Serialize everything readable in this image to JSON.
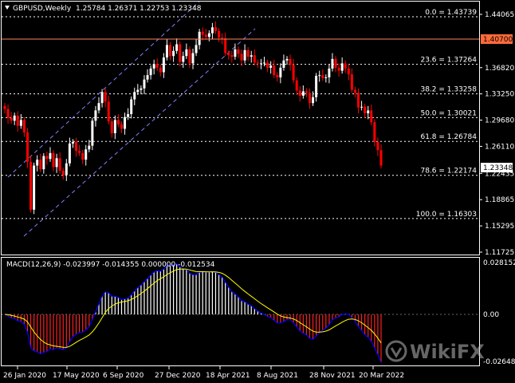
{
  "header": {
    "symbol_tf": "GBPUSD,Weekly",
    "ohlc": "1.25784 1.26371 1.22753 1.23348",
    "menu_icon": "triangle-down-icon"
  },
  "price_axis": {
    "ticks": [
      "1.44065",
      "1.40700",
      "1.36820",
      "1.33250",
      "1.29680",
      "1.26110",
      "1.22435",
      "1.18865",
      "1.15295",
      "1.11725"
    ],
    "current_price": "1.23348",
    "hline_price": "1.40700"
  },
  "fibo": [
    {
      "level": "0.0 = 1.43739"
    },
    {
      "level": "23.6 = 1.37264"
    },
    {
      "level": "38.2 = 1.33258"
    },
    {
      "level": "50.0 = 1.30021"
    },
    {
      "level": "61.8 = 1.26784"
    },
    {
      "level": "78.6 = 1.22174"
    },
    {
      "level": "100.0 = 1.16303"
    }
  ],
  "macd": {
    "label": "MACD(12,26,9) -0.023997 -0.014355 0.000000 -0.012534",
    "ticks": [
      "0.028152",
      "0.00",
      "-0.026481"
    ]
  },
  "time_axis": {
    "labels": [
      "26 Jan 2020",
      "17 May 2020",
      "6 Sep 2020",
      "27 Dec 2020",
      "18 Apr 2021",
      "8 Aug 2021",
      "28 Nov 2021",
      "20 Mar 2022"
    ]
  },
  "watermark": "WikiFX",
  "colors": {
    "bull": "#ffffff",
    "bear": "#ff0000",
    "grid": "#ffffff",
    "hline": "#ff8060",
    "channel": "#8080ff",
    "macd_main": "#0000ff",
    "macd_signal": "#ffff00",
    "hist_pos": "#ffffff",
    "hist_neg": "#ff2020",
    "price_tag_bg": "#ffffff",
    "hline_tag_bg": "#ff6a3a"
  },
  "chart_data": {
    "type": "candlestick",
    "x_start": "2020-01-26",
    "x_end": "2022-04-17",
    "price_range": [
      1.11725,
      1.45
    ],
    "close": [
      1.312,
      1.3,
      1.296,
      1.303,
      1.289,
      1.297,
      1.28,
      1.24,
      1.175,
      1.235,
      1.243,
      1.23,
      1.248,
      1.244,
      1.252,
      1.233,
      1.245,
      1.228,
      1.222,
      1.238,
      1.265,
      1.267,
      1.255,
      1.252,
      1.243,
      1.257,
      1.262,
      1.296,
      1.31,
      1.32,
      1.335,
      1.322,
      1.295,
      1.279,
      1.297,
      1.291,
      1.285,
      1.301,
      1.305,
      1.325,
      1.335,
      1.338,
      1.34,
      1.352,
      1.358,
      1.367,
      1.373,
      1.368,
      1.362,
      1.382,
      1.399,
      1.384,
      1.391,
      1.4,
      1.376,
      1.384,
      1.393,
      1.374,
      1.388,
      1.399,
      1.417,
      1.413,
      1.41,
      1.415,
      1.423,
      1.418,
      1.409,
      1.408,
      1.388,
      1.385,
      1.383,
      1.393,
      1.387,
      1.378,
      1.392,
      1.383,
      1.385,
      1.375,
      1.374,
      1.374,
      1.375,
      1.368,
      1.371,
      1.358,
      1.355,
      1.368,
      1.378,
      1.38,
      1.372,
      1.351,
      1.337,
      1.33,
      1.336,
      1.334,
      1.32,
      1.328,
      1.357,
      1.358,
      1.354,
      1.355,
      1.367,
      1.38,
      1.368,
      1.364,
      1.374,
      1.367,
      1.359,
      1.338,
      1.334,
      1.314,
      1.315,
      1.306,
      1.31,
      1.294,
      1.267,
      1.256,
      1.235
    ]
  }
}
